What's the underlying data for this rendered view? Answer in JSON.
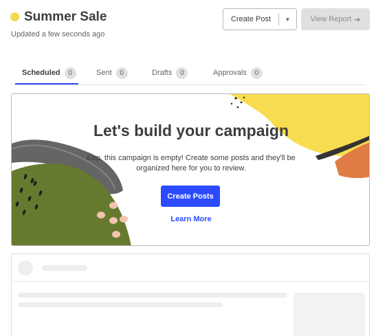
{
  "header": {
    "title": "Summer Sale",
    "updated": "Updated a few seconds ago",
    "create_post": "Create Post",
    "view_report": "View Report",
    "status_color": "#f5d84c"
  },
  "tabs": [
    {
      "label": "Scheduled",
      "count": "0",
      "active": true
    },
    {
      "label": "Sent",
      "count": "0"
    },
    {
      "label": "Drafts",
      "count": "0"
    },
    {
      "label": "Approvals",
      "count": "0"
    }
  ],
  "empty_state": {
    "heading": "Let's build your campaign",
    "message": "Eep, this campaign is empty! Create some posts and they'll be organized here for you to review.",
    "primary_button": "Create Posts",
    "link": "Learn More"
  },
  "icons": {
    "dropdown": "chevron-down-icon",
    "view_report": "arrow-right-icon"
  },
  "colors": {
    "accent": "#2c4bff",
    "art_yellow": "#f7dc4f",
    "art_orange": "#e07c45",
    "art_green": "#667a2f",
    "art_peach": "#f2c4ad"
  }
}
